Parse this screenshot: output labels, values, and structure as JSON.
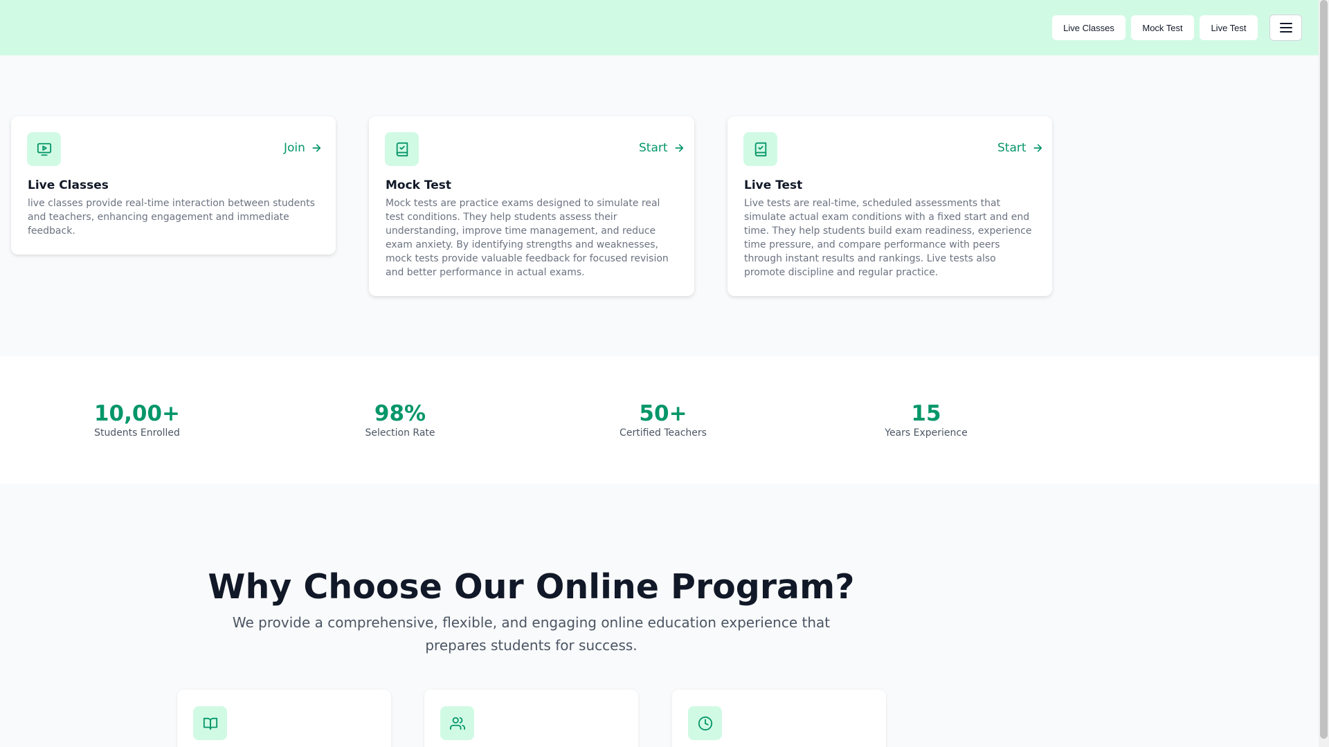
{
  "header": {
    "nav": [
      "Live Classes",
      "Mock Test",
      "Live Test"
    ],
    "menu_icon": "hamburger-icon",
    "bg_color": "#d1fae5"
  },
  "services": [
    {
      "icon": "video-play-icon",
      "link_label": "Join",
      "title": "Live Classes",
      "description": "live classes provide real-time interaction between students and teachers, enhancing engagement and immediate feedback."
    },
    {
      "icon": "book-check-icon",
      "link_label": "Start",
      "title": "Mock Test",
      "description": "Mock tests are practice exams designed to simulate real test conditions. They help students assess their understanding, improve time management, and reduce exam anxiety. By identifying strengths and weaknesses, mock tests provide valuable feedback for focused revision and better performance in actual exams."
    },
    {
      "icon": "book-check-icon",
      "link_label": "Start",
      "title": "Live Test",
      "description": "Live tests are real-time, scheduled assessments that simulate actual exam conditions with a fixed start and end time. They help students build exam readiness, experience time pressure, and compare performance with peers through instant results and rankings. Live tests also promote discipline and regular practice."
    }
  ],
  "stats": [
    {
      "value": "10,00+",
      "label": "Students Enrolled"
    },
    {
      "value": "98%",
      "label": "Selection Rate"
    },
    {
      "value": "50+",
      "label": "Certified Teachers"
    },
    {
      "value": "15",
      "label": "Years Experience"
    }
  ],
  "why": {
    "title": "Why Choose Our Online Program?",
    "subtitle": "We provide a comprehensive, flexible, and engaging online education experience that prepares students for success."
  },
  "features": [
    {
      "icon": "open-book-icon"
    },
    {
      "icon": "users-icon"
    },
    {
      "icon": "clock-icon"
    }
  ],
  "colors": {
    "accent": "#059669",
    "accent_light": "#d1fae5"
  }
}
